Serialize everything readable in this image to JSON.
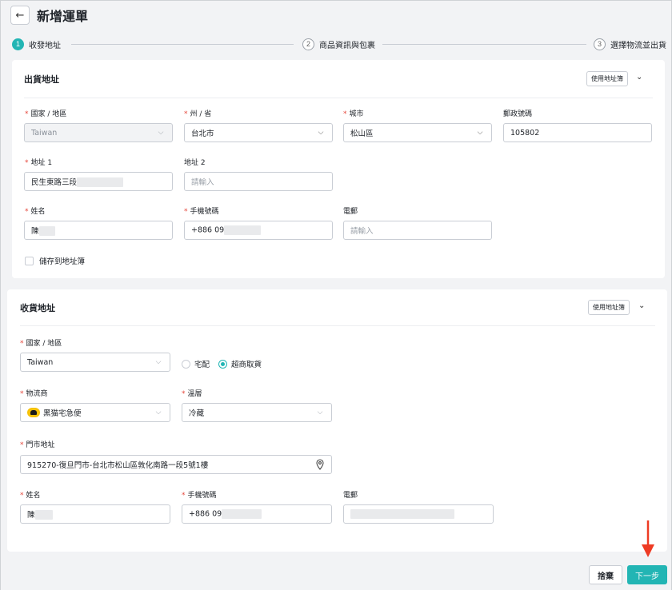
{
  "header": {
    "title": "新增運單",
    "back_icon": "←"
  },
  "steps": [
    {
      "num": "1",
      "label": "收發地址",
      "active": true
    },
    {
      "num": "2",
      "label": "商品資訊與包裹",
      "active": false
    },
    {
      "num": "3",
      "label": "選擇物流並出貨",
      "active": false
    }
  ],
  "sender": {
    "title": "出貨地址",
    "address_book_btn": "使用地址簿",
    "country_label": "國家 / 地區",
    "country_value": "Taiwan",
    "state_label": "州 / 省",
    "state_value": "台北市",
    "city_label": "城市",
    "city_value": "松山區",
    "zip_label": "郵政號碼",
    "zip_value": "105802",
    "addr1_label": "地址 1",
    "addr1_value": "民生東路三段",
    "addr2_label": "地址 2",
    "addr2_placeholder": "請輸入",
    "name_label": "姓名",
    "name_value": "陳",
    "phone_label": "手機號碼",
    "phone_value": "+886 09",
    "email_label": "電郵",
    "email_placeholder": "請輸入",
    "save_label": "儲存到地址簿"
  },
  "receiver": {
    "title": "收貨地址",
    "address_book_btn": "使用地址簿",
    "country_label": "國家 / 地區",
    "country_value": "Taiwan",
    "delivery_home": "宅配",
    "delivery_store": "超商取貨",
    "selected_delivery": "store",
    "carrier_label": "物流商",
    "carrier_value": "黑猫宅急便",
    "temp_label": "溫層",
    "temp_value": "冷藏",
    "store_label": "門市地址",
    "store_value": "915270-復旦門市-台北市松山區敦化南路一段5號1樓",
    "name_label": "姓名",
    "name_value": "陳",
    "phone_label": "手機號碼",
    "phone_value": "+886 09",
    "email_label": "電郵"
  },
  "footer": {
    "draft": "捨棄",
    "next": "下一步"
  }
}
